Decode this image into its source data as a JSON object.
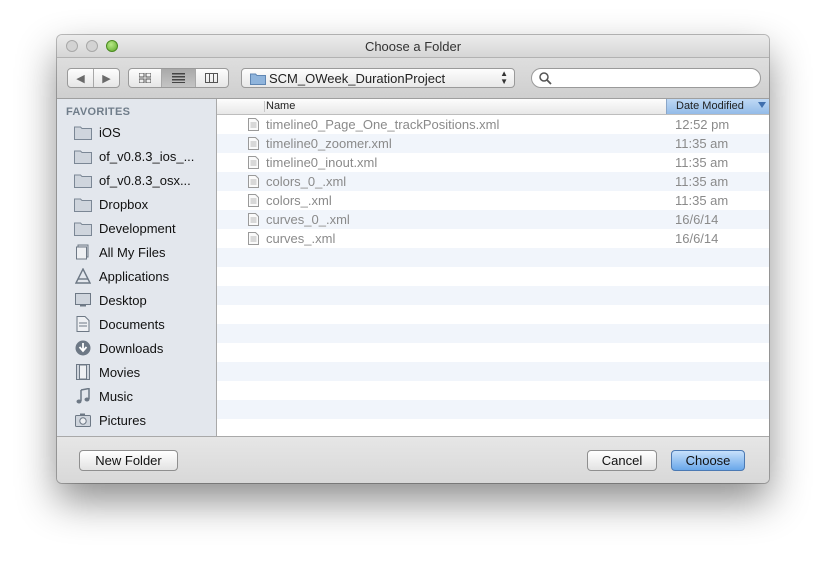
{
  "window": {
    "title": "Choose a Folder"
  },
  "toolbar": {
    "back_label": "◀",
    "forward_label": "▶",
    "location": "SCM_OWeek_DurationProject",
    "search_placeholder": ""
  },
  "sidebar": {
    "heading": "FAVORITES",
    "items": [
      {
        "label": "iOS",
        "icon": "folder-icon"
      },
      {
        "label": "of_v0.8.3_ios_...",
        "icon": "folder-icon"
      },
      {
        "label": "of_v0.8.3_osx...",
        "icon": "folder-icon"
      },
      {
        "label": "Dropbox",
        "icon": "folder-icon"
      },
      {
        "label": "Development",
        "icon": "folder-icon"
      },
      {
        "label": "All My Files",
        "icon": "all-files-icon"
      },
      {
        "label": "Applications",
        "icon": "applications-icon"
      },
      {
        "label": "Desktop",
        "icon": "desktop-icon"
      },
      {
        "label": "Documents",
        "icon": "documents-icon"
      },
      {
        "label": "Downloads",
        "icon": "downloads-icon"
      },
      {
        "label": "Movies",
        "icon": "movies-icon"
      },
      {
        "label": "Music",
        "icon": "music-icon"
      },
      {
        "label": "Pictures",
        "icon": "pictures-icon"
      }
    ]
  },
  "columns": {
    "name": "Name",
    "date": "Date Modified"
  },
  "files": [
    {
      "name": "timeline0_Page_One_trackPositions.xml",
      "date": "12:52 pm"
    },
    {
      "name": "timeline0_zoomer.xml",
      "date": "11:35 am"
    },
    {
      "name": "timeline0_inout.xml",
      "date": "11:35 am"
    },
    {
      "name": "colors_0_.xml",
      "date": "11:35 am"
    },
    {
      "name": "colors_.xml",
      "date": "11:35 am"
    },
    {
      "name": "curves_0_.xml",
      "date": "16/6/14"
    },
    {
      "name": "curves_.xml",
      "date": "16/6/14"
    }
  ],
  "buttons": {
    "new_folder": "New Folder",
    "cancel": "Cancel",
    "choose": "Choose"
  },
  "colors": {
    "accent": "#6aa7ea",
    "sidebar_bg": "#e3e7ed",
    "alt_row": "#f1f5fb"
  }
}
